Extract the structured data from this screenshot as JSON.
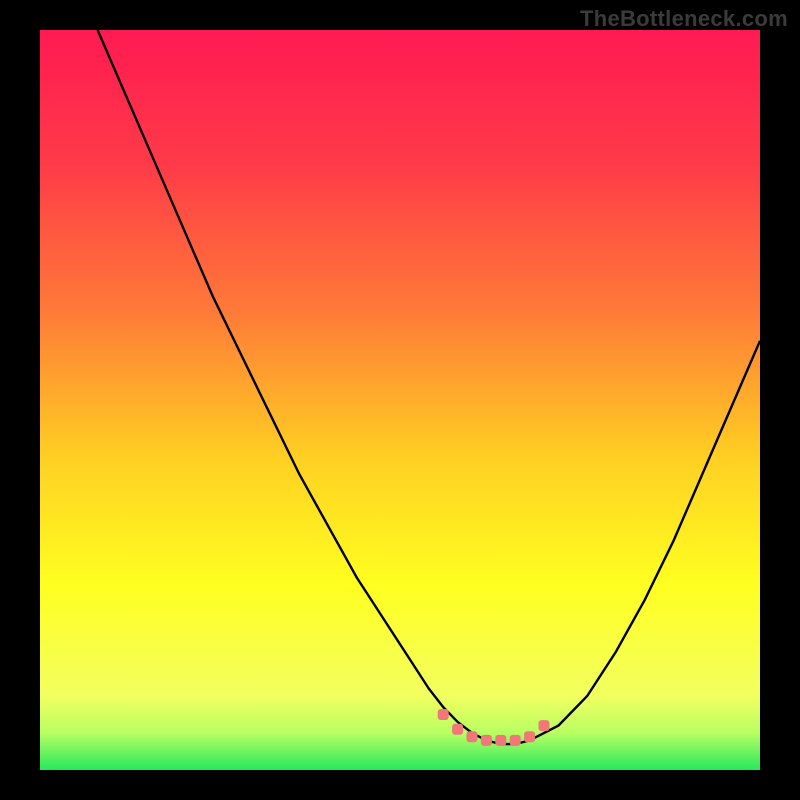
{
  "watermark": "TheBottleneck.com",
  "colors": {
    "frame": "#000000",
    "watermark": "#3b3b3b",
    "curve": "#000000",
    "marker": "#f07878",
    "gradient_stops": [
      {
        "offset": 0.0,
        "color": "#ff1a52"
      },
      {
        "offset": 0.18,
        "color": "#ff3a48"
      },
      {
        "offset": 0.38,
        "color": "#ff7a38"
      },
      {
        "offset": 0.58,
        "color": "#ffd022"
      },
      {
        "offset": 0.75,
        "color": "#ffff20"
      },
      {
        "offset": 0.9,
        "color": "#f2ff60"
      },
      {
        "offset": 0.95,
        "color": "#b8ff62"
      },
      {
        "offset": 1.0,
        "color": "#27e85e"
      }
    ]
  },
  "chart_data": {
    "type": "line",
    "title": "",
    "xlabel": "",
    "ylabel": "",
    "xlim": [
      0,
      100
    ],
    "ylim": [
      0,
      100
    ],
    "series": [
      {
        "name": "curve",
        "x": [
          8,
          12,
          16,
          20,
          24,
          28,
          32,
          36,
          40,
          44,
          48,
          52,
          54,
          56,
          58,
          60,
          62,
          64,
          66,
          68,
          72,
          76,
          80,
          84,
          88,
          92,
          96,
          100
        ],
        "values": [
          100,
          91,
          82,
          73,
          64,
          56,
          48,
          40,
          33,
          26,
          20,
          14,
          11,
          8.5,
          6.5,
          5,
          4,
          3.5,
          3.5,
          4,
          6,
          10,
          16,
          23,
          31,
          40,
          49,
          58
        ]
      }
    ],
    "flat_bottom": {
      "x_start": 56,
      "x_end": 70,
      "y": 3.5
    },
    "markers": {
      "name": "highlight-dots",
      "x": [
        56,
        58,
        60,
        62,
        64,
        66,
        68,
        70
      ],
      "values": [
        7.5,
        5.5,
        4.5,
        4,
        4,
        4,
        4.5,
        6
      ]
    }
  }
}
